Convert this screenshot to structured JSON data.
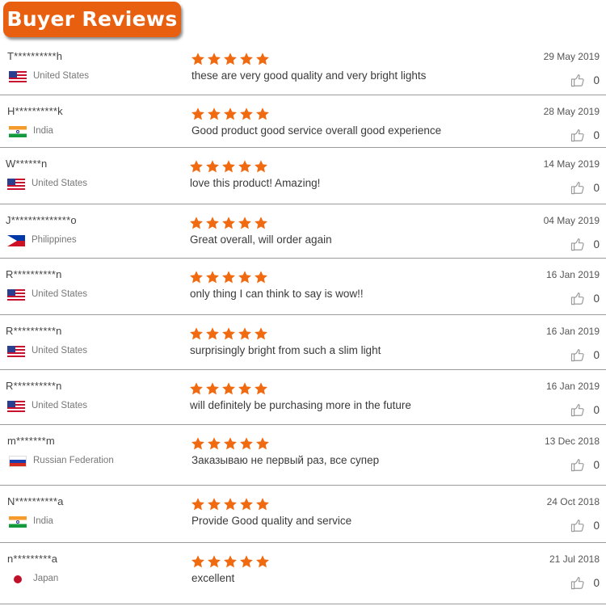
{
  "header": {
    "title": "Buyer Reviews"
  },
  "colors": {
    "accent": "#e8600f",
    "star": "#f26a10"
  },
  "reviews": [
    {
      "name": "T**********h",
      "country": "United States",
      "flag": "us",
      "rating": 5,
      "text": "these are very good quality and very bright lights",
      "date": "29 May 2019",
      "likes": "0"
    },
    {
      "name": "H**********k",
      "country": "India",
      "flag": "in",
      "rating": 5,
      "text": "Good product good service overall good experience",
      "date": "28 May 2019",
      "likes": "0"
    },
    {
      "name": "W******n",
      "country": "United States",
      "flag": "us",
      "rating": 5,
      "text": "love this product! Amazing!",
      "date": "14 May 2019",
      "likes": "0"
    },
    {
      "name": "J**************o",
      "country": "Philippines",
      "flag": "ph",
      "rating": 5,
      "text": "Great overall, will order again",
      "date": "04 May 2019",
      "likes": "0"
    },
    {
      "name": "R**********n",
      "country": "United States",
      "flag": "us",
      "rating": 5,
      "text": "only thing I can think to say is wow!!",
      "date": "16 Jan 2019",
      "likes": "0"
    },
    {
      "name": "R**********n",
      "country": "United States",
      "flag": "us",
      "rating": 5,
      "text": "surprisingly bright from such a slim light",
      "date": "16 Jan 2019",
      "likes": "0"
    },
    {
      "name": "R**********n",
      "country": "United States",
      "flag": "us",
      "rating": 5,
      "text": "will definitely be purchasing more in the future",
      "date": "16 Jan 2019",
      "likes": "0"
    },
    {
      "name": "m*******m",
      "country": "Russian Federation",
      "flag": "ru",
      "rating": 5,
      "text": "Заказываю не первый раз, все супер",
      "date": "13 Dec 2018",
      "likes": "0"
    },
    {
      "name": "N**********a",
      "country": "India",
      "flag": "in",
      "rating": 5,
      "text": "Provide Good quality and service",
      "date": "24 Oct 2018",
      "likes": "0"
    },
    {
      "name": "n*********a",
      "country": "Japan",
      "flag": "jp",
      "rating": 5,
      "text": "excellent",
      "date": "21 Jul 2018",
      "likes": "0"
    }
  ]
}
